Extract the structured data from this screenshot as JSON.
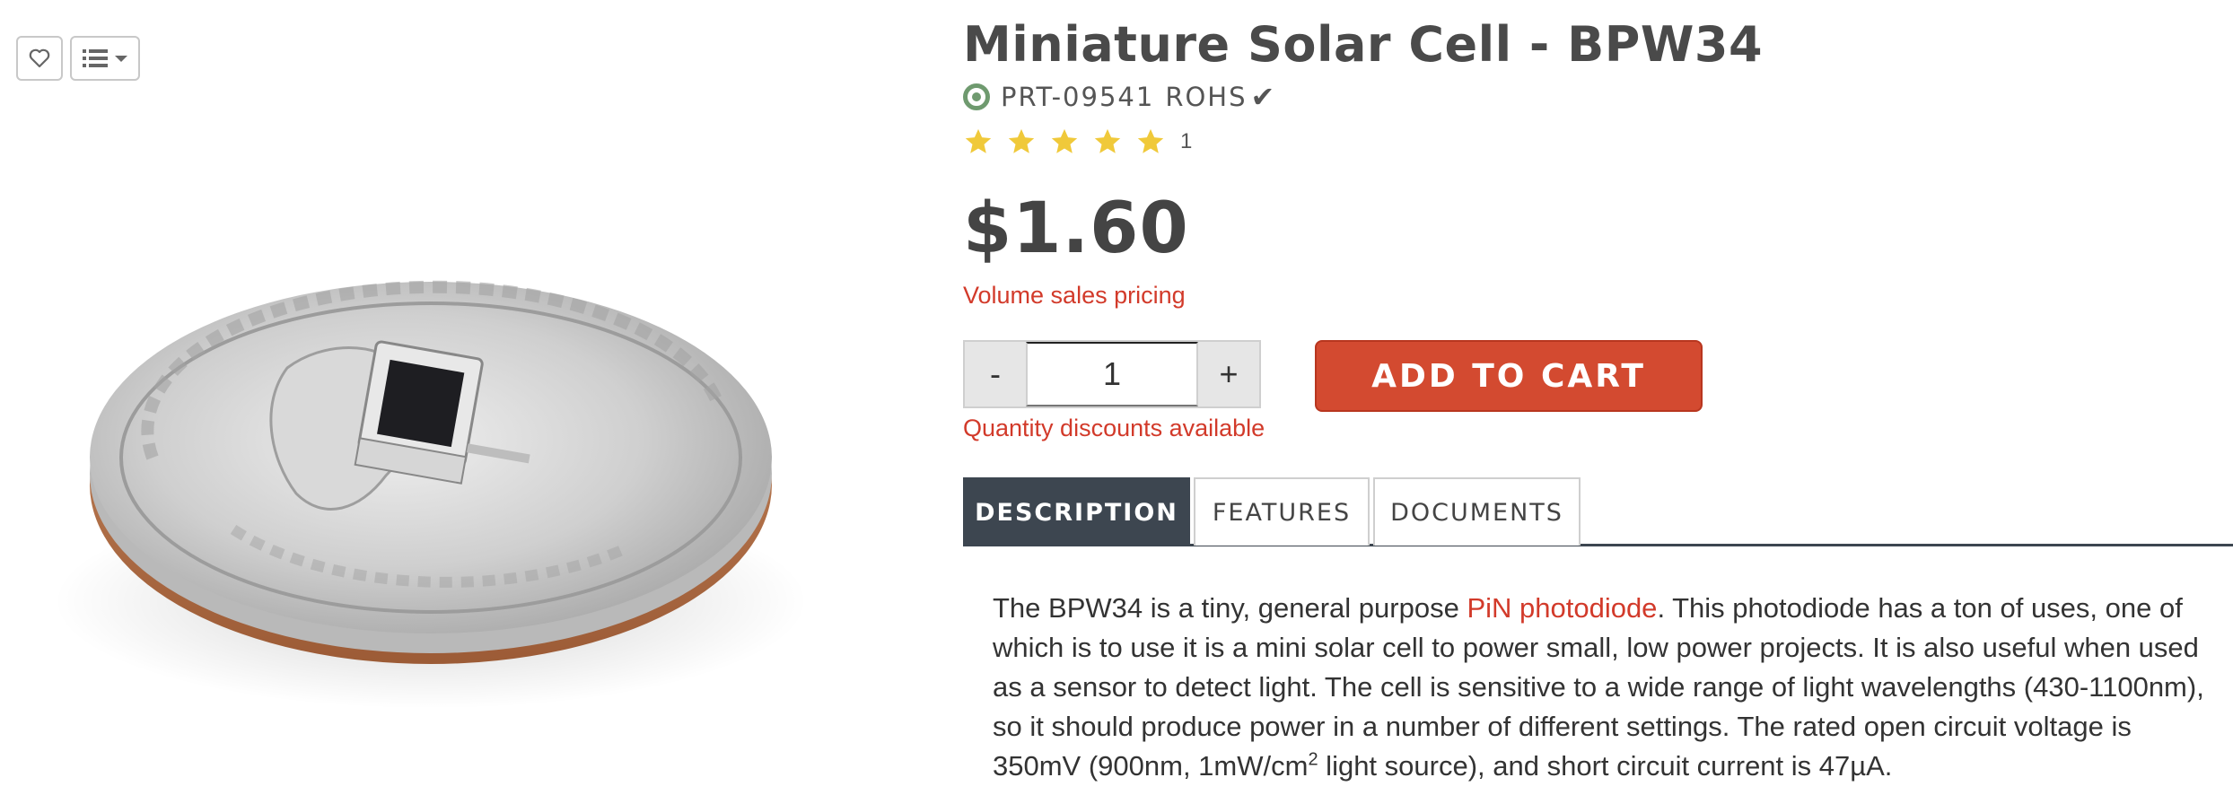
{
  "toolbar": {
    "wishlist_icon": "heart-icon",
    "list_icon": "list-icon",
    "dropdown_icon": "caret-down-icon"
  },
  "product": {
    "title": "Miniature Solar Cell - BPW34",
    "sku": "PRT-09541",
    "rohs": "ROHS",
    "rating_stars": 5,
    "rating_count": "1",
    "price": "$1.60",
    "volume_pricing_label": "Volume sales pricing",
    "quantity_value": "1",
    "qty_minus": "-",
    "qty_plus": "+",
    "quantity_discounts_label": "Quantity discounts available",
    "add_to_cart_label": "ADD TO CART"
  },
  "tabs": [
    {
      "label": "DESCRIPTION",
      "active": true
    },
    {
      "label": "FEATURES",
      "active": false
    },
    {
      "label": "DOCUMENTS",
      "active": false
    }
  ],
  "description": {
    "part1": "The BPW34 is a tiny, general purpose ",
    "link": "PiN photodiode",
    "part2": ". This photodiode has a ton of uses, one of which is to use it is a mini solar cell to power small, low power projects. It is also useful when used as a sensor to detect light. The cell is sensitive to a wide range of light wavelengths (430-1100nm), so it should produce power in a number of different settings. The rated open circuit voltage is 350mV (900nm, 1mW/cm",
    "sup": "2",
    "part3": " light source), and short circuit current is 47µA."
  },
  "colors": {
    "accent_red": "#d34a30",
    "link_red": "#d23a2a",
    "tab_active_bg": "#3d4650",
    "star_yellow": "#f0c93a",
    "status_green": "#6f9a6f"
  }
}
